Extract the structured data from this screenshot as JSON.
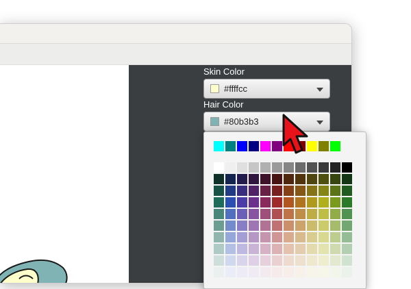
{
  "skin_color": {
    "label": "Skin Color",
    "value": "#ffffcc",
    "swatch_color": "#ffffcc"
  },
  "hair_color": {
    "label": "Hair Color",
    "value": "#80b3b3",
    "swatch_color": "#80b3b3"
  },
  "palette": {
    "recent": [
      "#00ffff",
      "#008080",
      "#0000ff",
      "#000080",
      "#ff00ff",
      "#800080",
      "#ff0000",
      "#800000",
      "#ffff00",
      "#808000",
      "#00ff00"
    ],
    "grays": [
      "#ffffff",
      "#efefef",
      "#dfdfdf",
      "#c6c6c6",
      "#b0b0b0",
      "#9a9a9a",
      "#858585",
      "#6b6b6b",
      "#525252",
      "#3a3a3a",
      "#232323",
      "#000000"
    ],
    "hues": [
      "#1e6b5a",
      "#2a4fb0",
      "#4b3ca8",
      "#6b2f8c",
      "#8a2a5c",
      "#a02a2a",
      "#b0561e",
      "#b0741e",
      "#b09a1e",
      "#b0b01e",
      "#7a9a1e",
      "#2a7a2a"
    ]
  },
  "colors": {
    "panel_bg": "#3a3e41",
    "cursor_fill": "#e8121a"
  }
}
